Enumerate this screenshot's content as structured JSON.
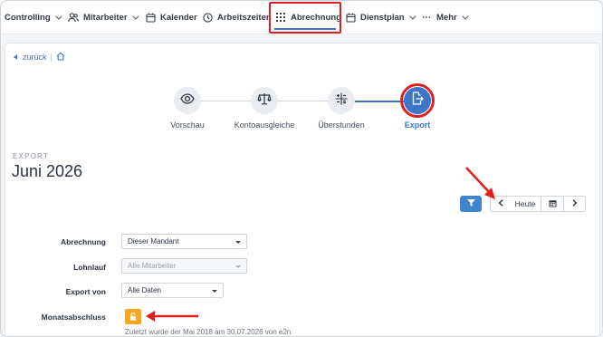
{
  "nav": {
    "items": [
      {
        "label": "Controlling",
        "icon": "none",
        "dropdown": true
      },
      {
        "label": "Mitarbeiter",
        "icon": "users-icon",
        "dropdown": true
      },
      {
        "label": "Kalender",
        "icon": "calendar-icon",
        "dropdown": false
      },
      {
        "label": "Arbeitszeiten",
        "icon": "clock-icon",
        "dropdown": false
      },
      {
        "label": "Abrechnung",
        "icon": "grid-icon",
        "dropdown": false,
        "active": true
      },
      {
        "label": "Dienstplan",
        "icon": "calendar-icon",
        "dropdown": true
      },
      {
        "label": "Mehr",
        "icon": "ellipsis-icon",
        "dropdown": true
      }
    ]
  },
  "breadcrumb": {
    "back_label": "zurück",
    "separator": "|",
    "home_icon": "home-icon"
  },
  "steps": [
    {
      "label": "Vorschau",
      "icon": "eye-icon"
    },
    {
      "label": "Kontoausgleiche",
      "icon": "scale-icon"
    },
    {
      "label": "Überstunden",
      "icon": "plus-minus-icon"
    },
    {
      "label": "Export",
      "icon": "file-export-icon",
      "active": true
    }
  ],
  "header": {
    "kicker": "EXPORT",
    "title": "Juni 2026"
  },
  "toolbar": {
    "filter_icon": "filter-icon",
    "prev_icon": "chevron-left-icon",
    "today_label": "Heute",
    "calendar_icon": "calendar-icon",
    "next_icon": "chevron-right-icon"
  },
  "form": {
    "abrechnung": {
      "label": "Abrechnung",
      "value": "Dieser Mandant"
    },
    "lohnlauf": {
      "label": "Lohnlauf",
      "placeholder": "Alle Mitarbeiter"
    },
    "export_von": {
      "label": "Export von",
      "value": "Alle Daten"
    },
    "monatsabschluss": {
      "label": "Monatsabschluss",
      "icon": "lock-icon",
      "note": "Zuletzt wurde der Mai 2018 am 30.07.2026 von e2n"
    }
  },
  "colors": {
    "accent": "#3d76c9",
    "annotation": "#e02020",
    "lock": "#f5a623"
  }
}
